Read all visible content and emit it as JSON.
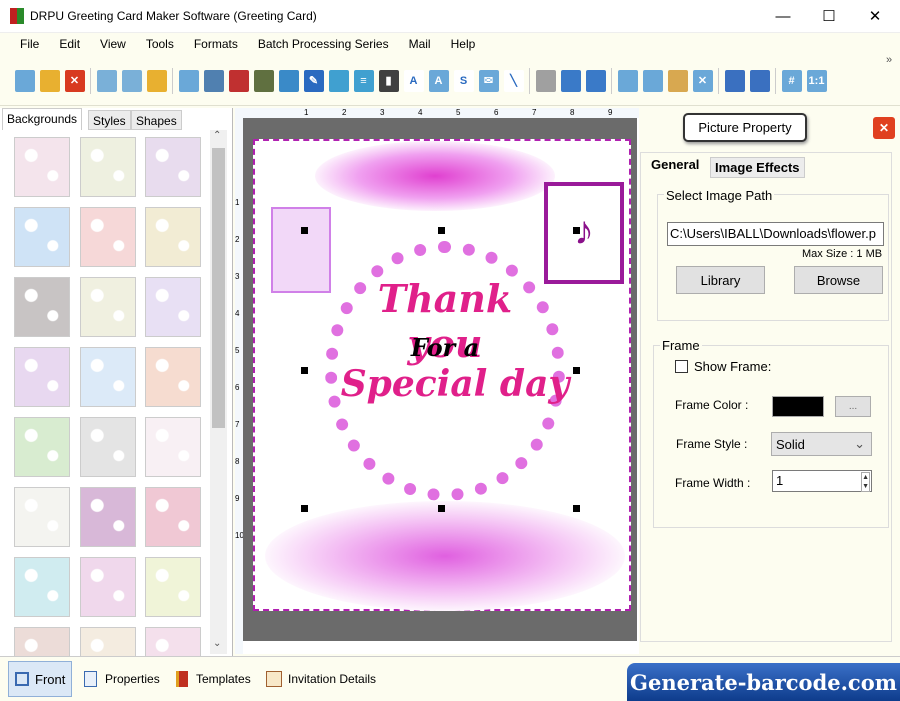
{
  "window": {
    "title": "DRPU Greeting Card Maker Software (Greeting Card)",
    "minimize": "—",
    "maximize": "☐",
    "close": "✕"
  },
  "menu": [
    "File",
    "Edit",
    "View",
    "Tools",
    "Formats",
    "Batch Processing Series",
    "Mail",
    "Help"
  ],
  "toolbar": {
    "icons": [
      {
        "name": "new-icon",
        "c": "#6aa8d8",
        "g": ""
      },
      {
        "name": "open-icon",
        "c": "#e8b030",
        "g": ""
      },
      {
        "name": "close-icon",
        "c": "#d83a20",
        "g": "✕"
      },
      "sep",
      {
        "name": "save-icon",
        "c": "#7ab0d8",
        "g": ""
      },
      {
        "name": "save-as-icon",
        "c": "#7ab0d8",
        "g": ""
      },
      {
        "name": "export-icon",
        "c": "#e8b030",
        "g": ""
      },
      "sep",
      {
        "name": "page-setup-icon",
        "c": "#6aa8d8",
        "g": ""
      },
      {
        "name": "print-icon",
        "c": "#5080b0",
        "g": ""
      },
      {
        "name": "print-preview-icon",
        "c": "#c03030",
        "g": ""
      },
      {
        "name": "background-icon",
        "c": "#607040",
        "g": ""
      },
      {
        "name": "insert-image-icon",
        "c": "#3a8ac8",
        "g": ""
      },
      {
        "name": "signature-icon",
        "c": "#2a6ac0",
        "g": "✎"
      },
      {
        "name": "shapes-icon",
        "c": "#40a0d0",
        "g": ""
      },
      {
        "name": "watermark-icon",
        "c": "#40a0d0",
        "g": "≡"
      },
      {
        "name": "barcode-icon",
        "c": "#404040",
        "g": "▮"
      },
      {
        "name": "text-icon",
        "c": "#fff",
        "g": "A"
      },
      {
        "name": "wordart-icon",
        "c": "#6aa8d8",
        "g": "A"
      },
      {
        "name": "symbol-icon",
        "c": "#fff",
        "g": "S"
      },
      {
        "name": "email-icon",
        "c": "#6aa8d8",
        "g": "✉"
      },
      {
        "name": "line-icon",
        "c": "#fff",
        "g": "╲"
      },
      "sep",
      {
        "name": "database-icon",
        "c": "#a0a0a0",
        "g": ""
      },
      {
        "name": "undo-icon",
        "c": "#3a7ac8",
        "g": ""
      },
      {
        "name": "redo-icon",
        "c": "#3a7ac8",
        "g": ""
      },
      "sep",
      {
        "name": "cut-icon",
        "c": "#6aa8d8",
        "g": ""
      },
      {
        "name": "copy-icon",
        "c": "#6aa8d8",
        "g": ""
      },
      {
        "name": "paste-icon",
        "c": "#d8a850",
        "g": ""
      },
      {
        "name": "delete-icon",
        "c": "#6aa8d8",
        "g": "✕"
      },
      "sep",
      {
        "name": "bring-front-icon",
        "c": "#3a70c0",
        "g": ""
      },
      {
        "name": "send-back-icon",
        "c": "#3a70c0",
        "g": ""
      },
      "sep",
      {
        "name": "grid-icon",
        "c": "#6aa8d8",
        "g": "#"
      },
      {
        "name": "actual-size-icon",
        "c": "#6aa8d8",
        "g": "1:1"
      }
    ],
    "overflow": "»"
  },
  "left_panel": {
    "tabs": [
      "Backgrounds",
      "Styles",
      "Shapes"
    ],
    "thumbs": [
      "#f4e4ec",
      "#eef0e0",
      "#e8dcee",
      "#cfe3f6",
      "#f6d8d8",
      "#f2ecd4",
      "#c8c4c4",
      "#f0f0e0",
      "#e8e0f4",
      "#e8d8f0",
      "#dceaf8",
      "#f6dcd0",
      "#d8ecd0",
      "#e4e4e4",
      "#f8f0f4",
      "#f4f4f0",
      "#d8b8d8",
      "#f0c8d4",
      "#d0ecf0",
      "#f0d8ec",
      "#f0f4d8",
      "#ecdcd8",
      "#f4ece0",
      "#f4e0ec"
    ]
  },
  "ruler": {
    "h": [
      "1",
      "2",
      "3",
      "4",
      "5",
      "6",
      "7",
      "8",
      "9"
    ],
    "v": [
      "1",
      "2",
      "3",
      "4",
      "5",
      "6",
      "7",
      "8",
      "9",
      "10"
    ]
  },
  "card": {
    "line1": "Thank you",
    "line2": "For a",
    "line3": "Special day"
  },
  "right_panel": {
    "title": "Picture Property",
    "tabs": [
      "General",
      "Image Effects"
    ],
    "image_path_group": "Select Image Path",
    "path": "C:\\Users\\IBALL\\Downloads\\flower.p",
    "max_size": "Max Size : 1 MB",
    "library": "Library",
    "browse": "Browse",
    "frame_group": "Frame",
    "show_frame": "Show Frame:",
    "show_frame_checked": false,
    "frame_color_label": "Frame Color :",
    "frame_color": "#000000",
    "color_more": "...",
    "frame_style_label": "Frame Style :",
    "frame_style": "Solid",
    "frame_width_label": "Frame Width :",
    "frame_width": "1"
  },
  "bottom": {
    "tabs": [
      "Front",
      "Properties",
      "Templates",
      "Invitation Details"
    ],
    "brand": "Generate-barcode.com"
  }
}
